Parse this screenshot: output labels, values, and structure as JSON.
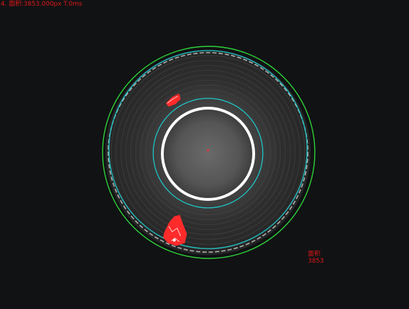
{
  "status": {
    "text": "4. 面积:3853.000px  T.0ms"
  },
  "measurement_label": {
    "name": "面积",
    "value": "3853"
  },
  "colors": {
    "background": "#111214",
    "outer_circle": "#2fd33a",
    "ring_circle": "#1fc6c8",
    "hole_edge": "#ffffff",
    "defect": "#ff2b2b",
    "text": "#e01818"
  }
}
